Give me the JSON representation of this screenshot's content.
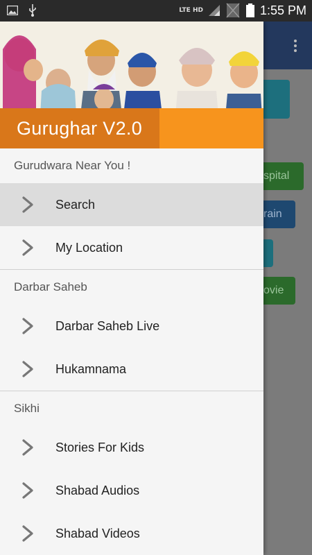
{
  "status_bar": {
    "network_label": "LTE HD",
    "time": "1:55 PM",
    "icons": [
      "image-icon",
      "usb-icon",
      "signal-icon",
      "no-sim-icon",
      "battery-icon"
    ]
  },
  "drawer": {
    "app_title": "Gurughar V2.0",
    "sections": [
      {
        "header": "Gurudwara Near You !",
        "items": [
          {
            "label": "Search",
            "selected": true
          },
          {
            "label": "My Location",
            "selected": false
          }
        ]
      },
      {
        "header": "Darbar Saheb",
        "items": [
          {
            "label": "Darbar Saheb Live",
            "selected": false
          },
          {
            "label": "Hukamnama",
            "selected": false
          }
        ]
      },
      {
        "header": "Sikhi",
        "items": [
          {
            "label": "Stories For Kids",
            "selected": false
          },
          {
            "label": "Shabad Audios",
            "selected": false
          },
          {
            "label": "Shabad Videos",
            "selected": false
          }
        ]
      }
    ]
  },
  "background_app": {
    "buttons": [
      "spital",
      "rain",
      "ovie"
    ]
  },
  "colors": {
    "title_band": "#f7941d",
    "title_box": "#d9771a",
    "appbar": "#23385d"
  }
}
